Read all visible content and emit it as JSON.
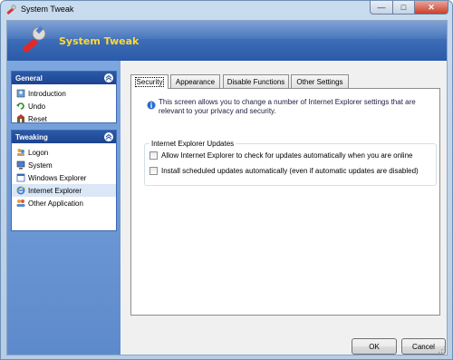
{
  "window": {
    "title": "System Tweak"
  },
  "titlebar": {
    "minimize": "—",
    "maximize": "□",
    "close": "✕"
  },
  "banner": {
    "title": "System Tweak"
  },
  "sidebar": {
    "groups": [
      {
        "title": "General",
        "items": [
          {
            "label": "Introduction",
            "icon": "introduction-icon"
          },
          {
            "label": "Undo",
            "icon": "undo-icon"
          },
          {
            "label": "Reset",
            "icon": "reset-icon"
          }
        ]
      },
      {
        "title": "Tweaking",
        "items": [
          {
            "label": "Logon",
            "icon": "users-icon"
          },
          {
            "label": "System",
            "icon": "monitor-icon"
          },
          {
            "label": "Windows Explorer",
            "icon": "window-icon"
          },
          {
            "label": "Internet Explorer",
            "icon": "ie-icon",
            "selected": true
          },
          {
            "label": "Other Application",
            "icon": "people-icon"
          }
        ]
      }
    ]
  },
  "tabs": [
    {
      "label": "Security",
      "active": true
    },
    {
      "label": "Appearance"
    },
    {
      "label": "Disable Functions"
    },
    {
      "label": "Other Settings"
    }
  ],
  "panel": {
    "info": "This screen allows you to change a number of Internet Explorer settings that are relevant to your privacy and security.",
    "group_title": "Internet Explorer Updates",
    "options": [
      {
        "label": "Allow Internet Explorer to check for updates automatically when you are online",
        "checked": false
      },
      {
        "label": "Install scheduled updates automatically (even if automatic updates are disabled)",
        "checked": false
      }
    ]
  },
  "buttons": {
    "ok": "OK",
    "cancel": "Cancel"
  },
  "colors": {
    "accent": "#2c5aa8",
    "banner_title": "#ffd83a",
    "sidebar_bg": "#6f98d6"
  }
}
